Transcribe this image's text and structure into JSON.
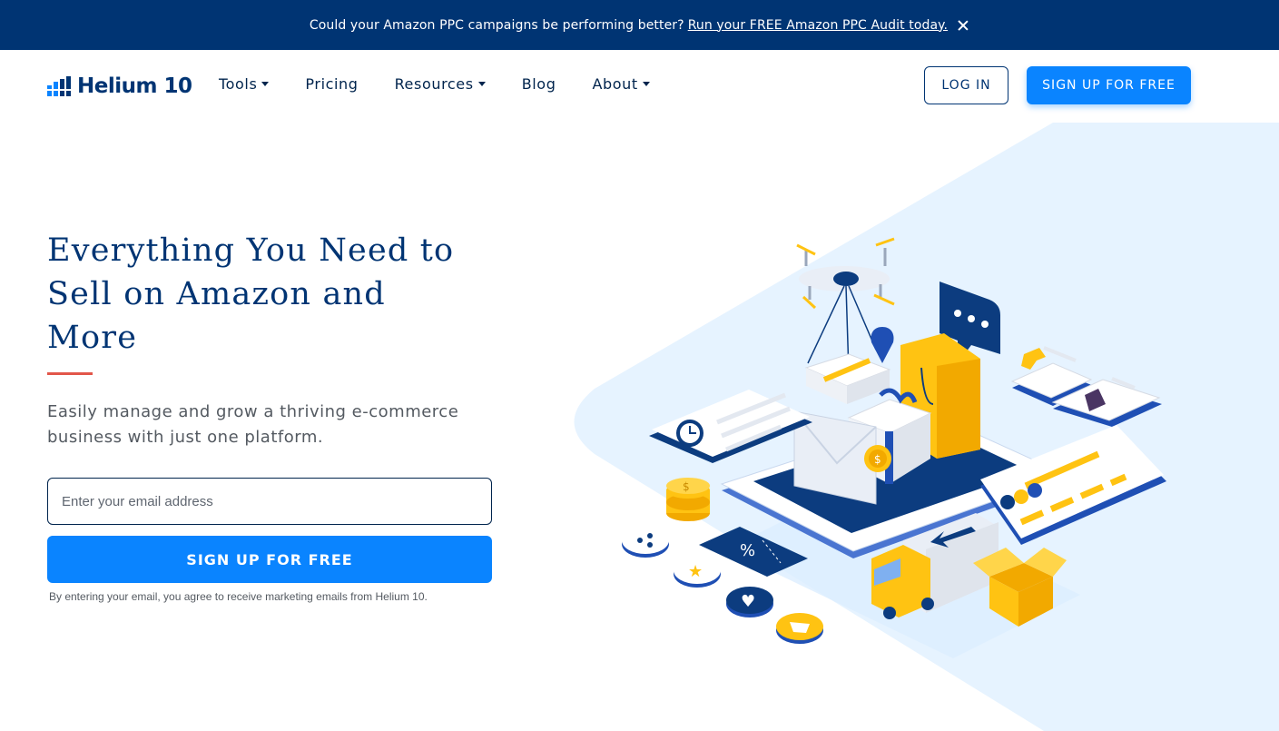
{
  "promo": {
    "text": "Could your Amazon PPC campaigns be performing better?",
    "link": "Run your FREE Amazon PPC Audit today."
  },
  "nav": {
    "logo": "Helium 10",
    "items": [
      {
        "label": "Tools",
        "dropdown": true
      },
      {
        "label": "Pricing",
        "dropdown": false
      },
      {
        "label": "Resources",
        "dropdown": true
      },
      {
        "label": "Blog",
        "dropdown": false
      },
      {
        "label": "About",
        "dropdown": true
      }
    ],
    "login": "LOG IN",
    "signup": "SIGN UP FOR FREE"
  },
  "hero": {
    "headline_line1": "Everything You Need to",
    "headline_line2": "Sell on Amazon and",
    "headline_line3": "More",
    "subtext": "Easily manage and grow a thriving e-commerce business with just one platform.",
    "email_placeholder": "Enter your email address",
    "cta": "SIGN UP FOR FREE",
    "disclaimer": "By entering your email, you agree to receive marketing emails from Helium 10."
  },
  "colors": {
    "brand_navy": "#003473",
    "cta_blue": "#0a84ff",
    "accent_red": "#e2564a",
    "light_blue_bg": "#e6f3ff",
    "illustration_yellow": "#ffc312"
  },
  "icons": [
    "close-icon",
    "helium10-logo-icon",
    "chevron-down-icon"
  ]
}
